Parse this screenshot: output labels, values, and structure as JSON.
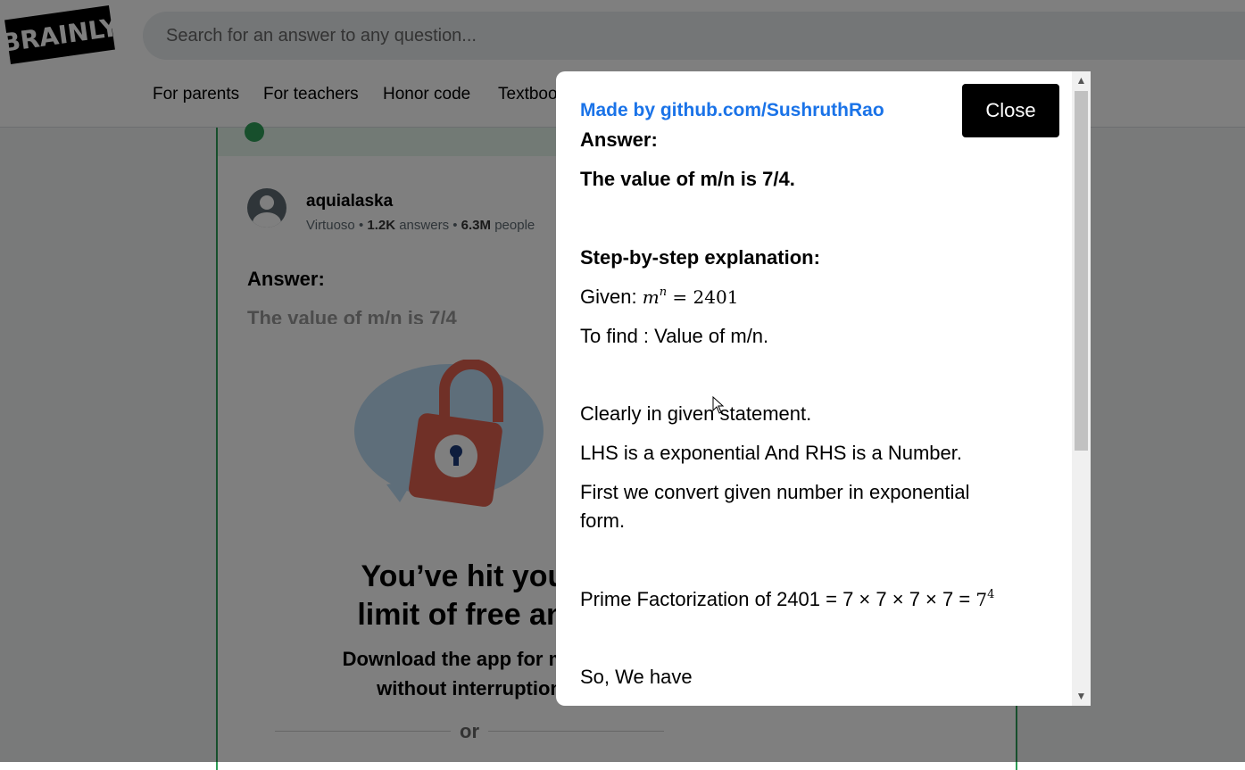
{
  "header": {
    "logo_text": "BRAINLY",
    "search_placeholder": "Search for an answer to any question..."
  },
  "nav": {
    "items": [
      "For parents",
      "For teachers",
      "Honor code",
      "Textbook"
    ]
  },
  "answer_card": {
    "username": "aquialaska",
    "rank": "Virtuoso",
    "answers_count": "1.2K",
    "answers_label": "answers",
    "people_count": "6.3M",
    "people_label": "people",
    "answer_label": "Answer:",
    "answer_preview": "The value of m/n is 7/4"
  },
  "paywall": {
    "title_line1": "You’ve hit your",
    "title_line2": "limit of free ans",
    "sub_line1": "Download the app for more",
    "sub_line2": "without interruption",
    "or_text": "or"
  },
  "modal": {
    "credit": "Made by github.com/SushruthRao",
    "close_label": "Close",
    "answer_heading": "Answer:",
    "answer_value": "The value of m/n is 7/4.",
    "step_heading": "Step-by-step explanation:",
    "given_label": "Given:",
    "given_m": "m",
    "given_n": "n",
    "given_eq": " = 2401",
    "to_find": "To find : Value of m/n.",
    "clearly": "Clearly in given statement.",
    "lhs": "LHS is a exponential And RHS is a Number.",
    "first_line1": "First we convert given number in exponential",
    "first_line2": "form.",
    "prime_text": "Prime Factorization of 2401 = 7 × 7 × 7 × 7 = ",
    "prime_base": "7",
    "prime_exp": "4",
    "so_we_have": "So, We have"
  },
  "colors": {
    "accent_link": "#1a73e8",
    "card_border": "#2f9e58",
    "overlay": "rgba(0,0,0,0.5)"
  }
}
